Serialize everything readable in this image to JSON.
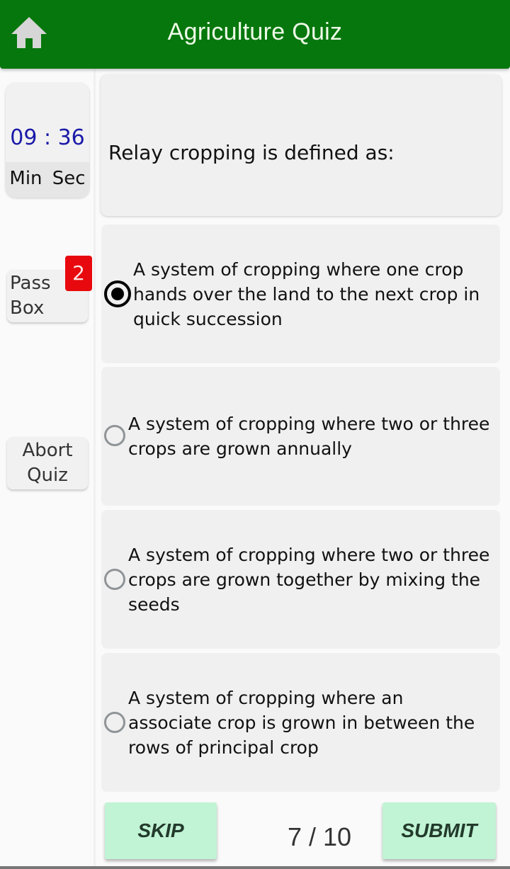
{
  "app": {
    "title": "Agriculture Quiz",
    "home_icon": "home-icon",
    "header_color": "#06770d"
  },
  "sidebar": {
    "timer": {
      "value": "09 : 36",
      "units": "Min  Sec"
    },
    "pass_box": {
      "label": "Pass Box",
      "count": "2"
    },
    "abort": {
      "label": "Abort Quiz"
    }
  },
  "question": {
    "text": "Relay cropping is defined as:",
    "options": [
      {
        "text": "A system of cropping where one crop hands over the land to the next crop in quick succession",
        "selected": true
      },
      {
        "text": "A system of cropping where two or three crops are grown annually",
        "selected": false
      },
      {
        "text": "A system of cropping where two or three crops are grown together by mixing the seeds",
        "selected": false
      },
      {
        "text": "A system of cropping where an associate crop is grown in between the rows of principal crop",
        "selected": false
      }
    ]
  },
  "footer": {
    "skip_label": "SKIP",
    "submit_label": "SUBMIT",
    "progress": "7 / 10",
    "current": 7,
    "total": 10
  }
}
